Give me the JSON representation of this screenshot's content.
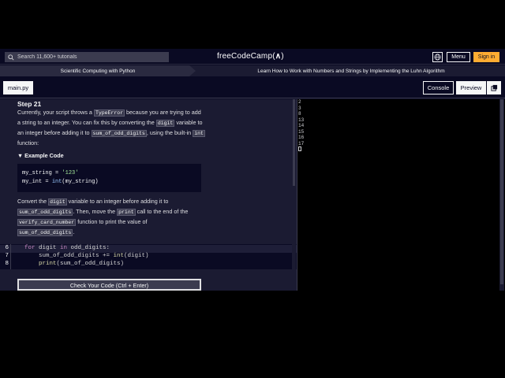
{
  "nav": {
    "search_placeholder": "Search 11,600+ tutorials",
    "logo": "freeCodeCamp(🔥)",
    "logo_text": "freeCodeCamp(",
    "logo_end": ")",
    "menu_label": "Menu",
    "signin_label": "Sign in"
  },
  "breadcrumb": {
    "course": "Scientific Computing with Python",
    "project": "Learn How to Work with Numbers and Strings by Implementing the Luhn Algorithm"
  },
  "tabs": {
    "file": "main.py",
    "console": "Console",
    "preview": "Preview"
  },
  "instructions": {
    "step_title": "Step 21",
    "p1_a": "Currently, your script throws a",
    "p1_code1": "TypeError",
    "p1_b": "because you are trying to",
    "p1_c": "add a string to an integer. You can fix this by converting the",
    "p1_code2": "digit",
    "p1_d": "variable to an integer before adding it to",
    "p1_code3": "sum_of_odd_digits",
    "p1_e": ", using",
    "p1_f": "the built-in",
    "p1_code4": "int",
    "p1_g": "function:",
    "example_heading": "▼ Example Code",
    "example_line1_a": "my_string = ",
    "example_line1_str": "'123'",
    "example_line2_a": "my_int = ",
    "example_line2_fn": "int",
    "example_line2_b": "(my_string)",
    "p2_a": "Convert the",
    "p2_code1": "digit",
    "p2_b": "variable to an integer before adding it to",
    "p2_code2": "sum_of_odd_digits",
    "p2_c": ". Then, move the",
    "p2_code3": "print",
    "p2_d": "call to the end of the",
    "p2_code4": "verify_card_number",
    "p2_e": "function to print the value of",
    "p2_code5": "sum_of_odd_digits",
    "p2_f": "."
  },
  "editor": {
    "lines": [
      {
        "num": "6",
        "kw": "for",
        "rest": " digit ",
        "kw2": "in",
        "rest2": " odd_digits:"
      },
      {
        "num": "7",
        "pre": "    sum_of_odd_digits += ",
        "fn": "int",
        "post": "(digit)"
      },
      {
        "num": "8",
        "pre": "    ",
        "fn": "print",
        "post": "(sum_of_odd_digits)"
      }
    ]
  },
  "check_button": "Check Your Code (Ctrl + Enter)",
  "console_output": [
    "2",
    "3",
    "8",
    "13",
    "14",
    "15",
    "16",
    "17"
  ]
}
